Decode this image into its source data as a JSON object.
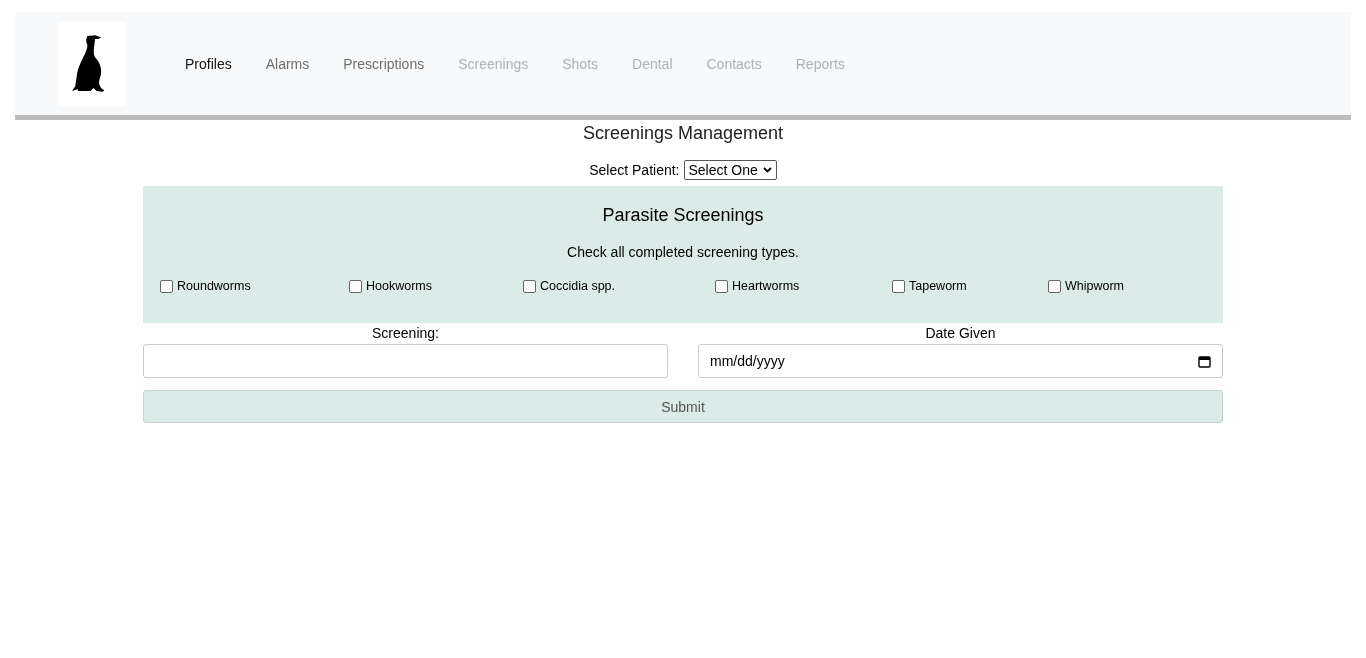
{
  "nav": {
    "items": [
      {
        "label": "Profiles",
        "selected": true,
        "disabled": false
      },
      {
        "label": "Alarms",
        "selected": false,
        "disabled": false
      },
      {
        "label": "Prescriptions",
        "selected": false,
        "disabled": false
      },
      {
        "label": "Screenings",
        "selected": false,
        "disabled": true
      },
      {
        "label": "Shots",
        "selected": false,
        "disabled": true
      },
      {
        "label": "Dental",
        "selected": false,
        "disabled": true
      },
      {
        "label": "Contacts",
        "selected": false,
        "disabled": true
      },
      {
        "label": "Reports",
        "selected": false,
        "disabled": true
      }
    ]
  },
  "page_title": "Screenings Management",
  "patient_select": {
    "label": "Select Patient:",
    "value": "Select One"
  },
  "panel": {
    "title": "Parasite Screenings",
    "instruction": "Check all completed screening types.",
    "options": [
      {
        "label": "Roundworms",
        "checked": false
      },
      {
        "label": "Hookworms",
        "checked": false
      },
      {
        "label": "Coccidia spp.",
        "checked": false
      },
      {
        "label": "Heartworms",
        "checked": false
      },
      {
        "label": "Tapeworm",
        "checked": false
      },
      {
        "label": "Whipworm",
        "checked": false
      }
    ]
  },
  "form": {
    "screening_label": "Screening:",
    "date_label": "Date Given",
    "date_placeholder": "mm/dd/yyyy",
    "submit": "Submit"
  }
}
